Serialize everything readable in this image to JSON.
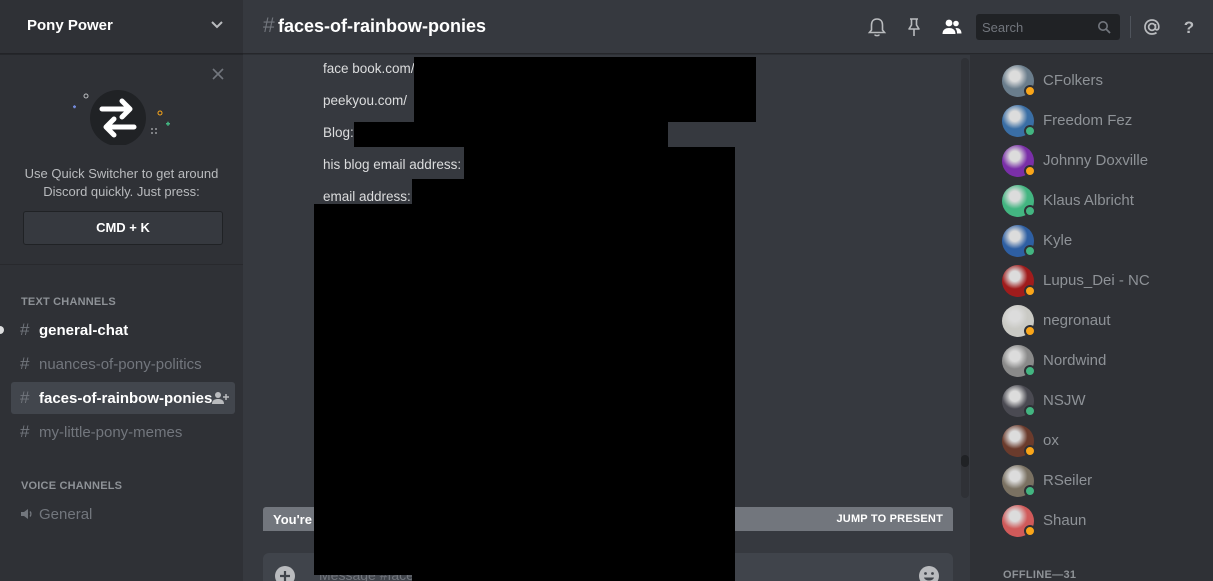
{
  "guild": {
    "name": "Pony Power"
  },
  "quick_switcher": {
    "line1": "Use Quick Switcher to get around",
    "line2": "Discord quickly. Just press:",
    "shortcut": "CMD + K"
  },
  "categories": {
    "text": "TEXT CHANNELS",
    "voice": "VOICE CHANNELS"
  },
  "channels": [
    {
      "name": "general-chat",
      "state": "unread"
    },
    {
      "name": "nuances-of-pony-politics",
      "state": "muted"
    },
    {
      "name": "faces-of-rainbow-ponies",
      "state": "active"
    },
    {
      "name": "my-little-pony-memes",
      "state": "muted"
    }
  ],
  "voice_channels": [
    {
      "name": "General"
    }
  ],
  "header": {
    "hash": "#",
    "channel": "faces-of-rainbow-ponies",
    "search_placeholder": "Search",
    "icons": [
      "bell-icon",
      "pin-icon",
      "members-icon",
      "mention-icon",
      "help-icon"
    ]
  },
  "messages": [
    "face book.com/",
    "peekyou.com/",
    "Blog:",
    "his blog email address:",
    "email address:"
  ],
  "jump_bar": {
    "left_text": "You're",
    "right_text": "JUMP TO PRESENT"
  },
  "composer": {
    "placeholder": "Message #face"
  },
  "members": [
    {
      "name": "CFolkers",
      "status": "idle",
      "avatar_color": "#6a7d8c"
    },
    {
      "name": "Freedom Fez",
      "status": "online",
      "avatar_color": "#3a6ea5"
    },
    {
      "name": "Johnny Doxville",
      "status": "idle",
      "avatar_color": "#7a2fa8"
    },
    {
      "name": "Klaus Albricht",
      "status": "online",
      "avatar_color": "#43b581"
    },
    {
      "name": "Kyle",
      "status": "online",
      "avatar_color": "#2e5fa3"
    },
    {
      "name": "Lupus_Dei - NC",
      "status": "idle",
      "avatar_color": "#a01c1c"
    },
    {
      "name": "negronaut",
      "status": "idle",
      "avatar_color": "#c9c9c4"
    },
    {
      "name": "Nordwind",
      "status": "online",
      "avatar_color": "#8a8a8a"
    },
    {
      "name": "NSJW",
      "status": "online",
      "avatar_color": "#4a4a52"
    },
    {
      "name": "ox",
      "status": "idle",
      "avatar_color": "#6b3b2c"
    },
    {
      "name": "RSeiler",
      "status": "online",
      "avatar_color": "#7a7162"
    },
    {
      "name": "Shaun",
      "status": "idle",
      "avatar_color": "#d05a5a"
    }
  ],
  "offline_label": "OFFLINE—31",
  "colors": {
    "online": "#43b581",
    "idle": "#faa61a",
    "accent": "#7289da"
  }
}
